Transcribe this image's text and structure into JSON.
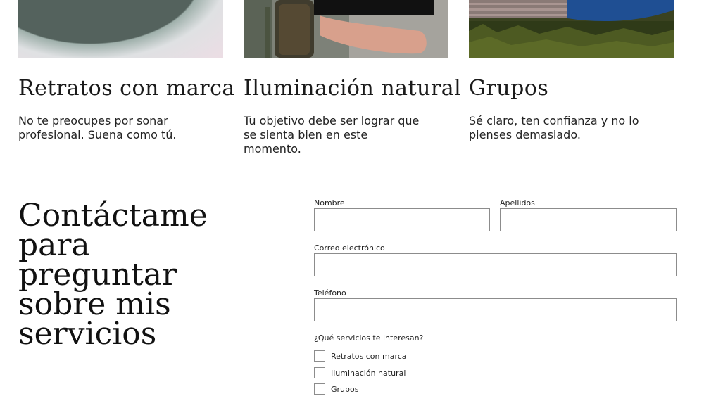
{
  "cards": [
    {
      "title": "Retratos con marca",
      "text": "No te preocupes por sonar profesional. Suena como tú."
    },
    {
      "title": "Iluminación natural",
      "text": "Tu objetivo debe ser lograr que se sienta bien en este momento."
    },
    {
      "title": "Grupos",
      "text": "Sé claro, ten confianza y no lo pienses demasiado."
    }
  ],
  "contact": {
    "heading": "Contáctame para preguntar sobre mis servicios",
    "first_name_label": "Nombre",
    "last_name_label": "Apellidos",
    "email_label": "Correo electrónico",
    "phone_label": "Teléfono",
    "services_question": "¿Qué servicios te interesan?",
    "services": [
      "Retratos con marca",
      "Iluminación natural",
      "Grupos"
    ]
  }
}
